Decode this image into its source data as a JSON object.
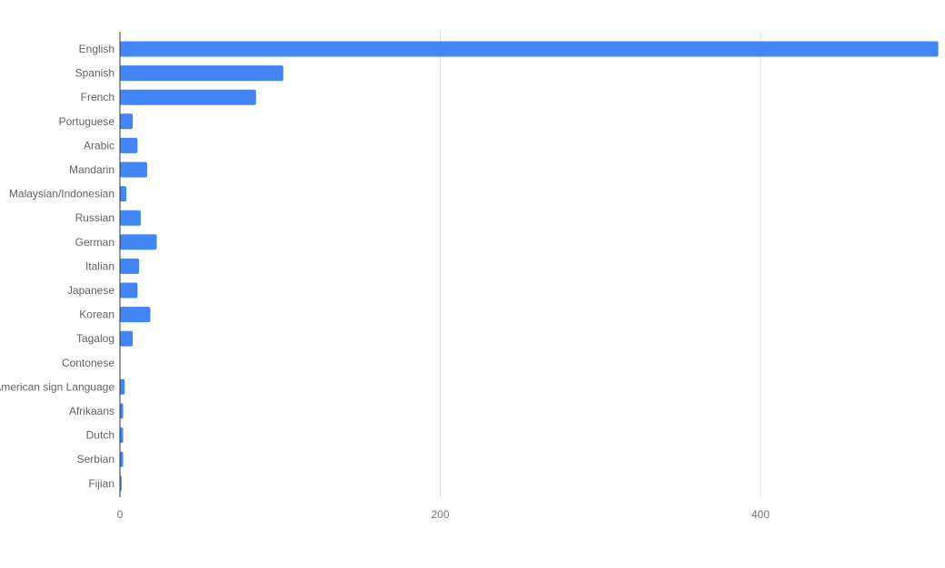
{
  "chart_data": {
    "type": "bar",
    "orientation": "horizontal",
    "title": "",
    "xlabel": "",
    "ylabel": "",
    "categories": [
      "English",
      "Spanish",
      "French",
      "Portuguese",
      "Arabic",
      "Mandarin",
      "Malaysian/Indonesian",
      "Russian",
      "German",
      "Italian",
      "Japanese",
      "Korean",
      "Tagalog",
      "Contonese",
      "American sign Language",
      "Afrikaans",
      "Dutch",
      "Serbian",
      "Fijian"
    ],
    "values": [
      511,
      102,
      85,
      8,
      11,
      17,
      4,
      13,
      23,
      12,
      11,
      19,
      8,
      0,
      3,
      2,
      2,
      2,
      1
    ],
    "xlim": [
      0,
      511
    ],
    "xticks": [
      0,
      200,
      400
    ],
    "xtick_labels": [
      "0",
      "200",
      "400"
    ],
    "grid": true,
    "legend": "none",
    "bar_color": "#4285f4",
    "grid_color": "#e0e0e0",
    "axis_color": "#333333"
  }
}
